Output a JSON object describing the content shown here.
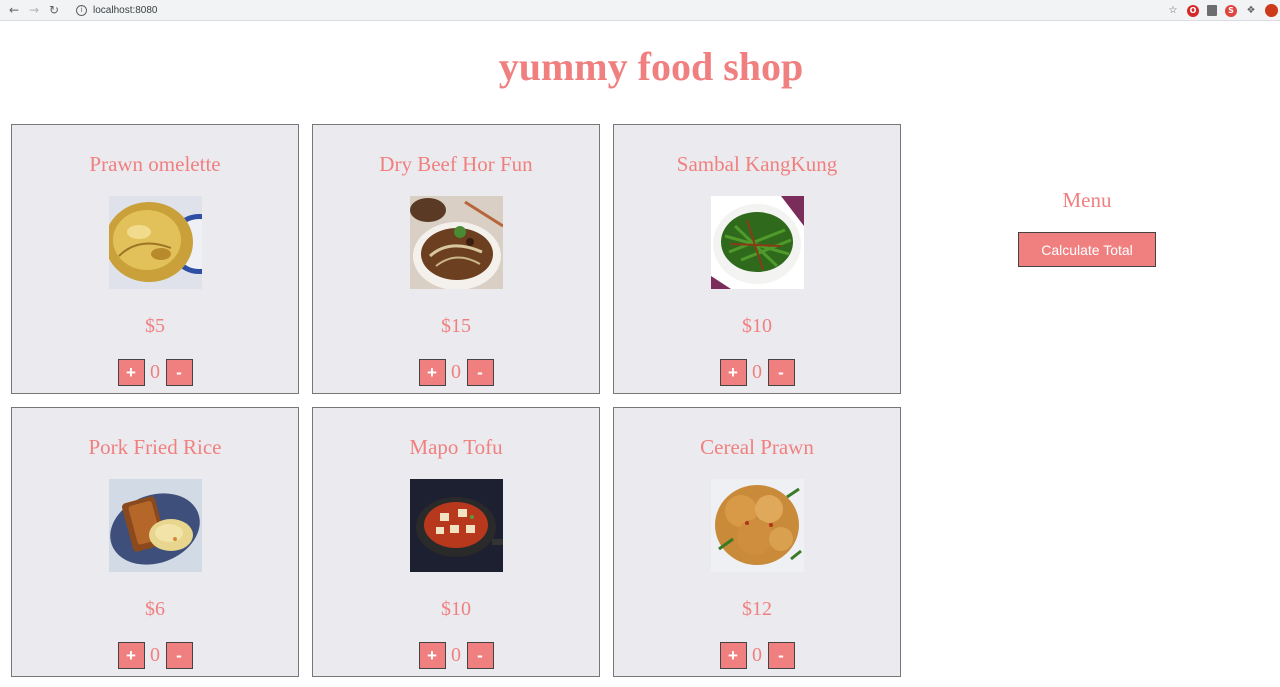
{
  "browser": {
    "url": "localhost:8080"
  },
  "page": {
    "title": "yummy food shop"
  },
  "menu": {
    "title": "Menu",
    "calculate_label": "Calculate Total"
  },
  "controls": {
    "plus": "+",
    "minus": "-"
  },
  "items": [
    {
      "name": "Prawn omelette",
      "price": "$5",
      "qty": "0",
      "image": "omelette"
    },
    {
      "name": "Dry Beef Hor Fun",
      "price": "$15",
      "qty": "0",
      "image": "noodles"
    },
    {
      "name": "Sambal KangKung",
      "price": "$10",
      "qty": "0",
      "image": "greens"
    },
    {
      "name": "Pork Fried Rice",
      "price": "$6",
      "qty": "0",
      "image": "pork-rice"
    },
    {
      "name": "Mapo Tofu",
      "price": "$10",
      "qty": "0",
      "image": "tofu"
    },
    {
      "name": "Cereal Prawn",
      "price": "$12",
      "qty": "0",
      "image": "cereal-prawn"
    }
  ]
}
